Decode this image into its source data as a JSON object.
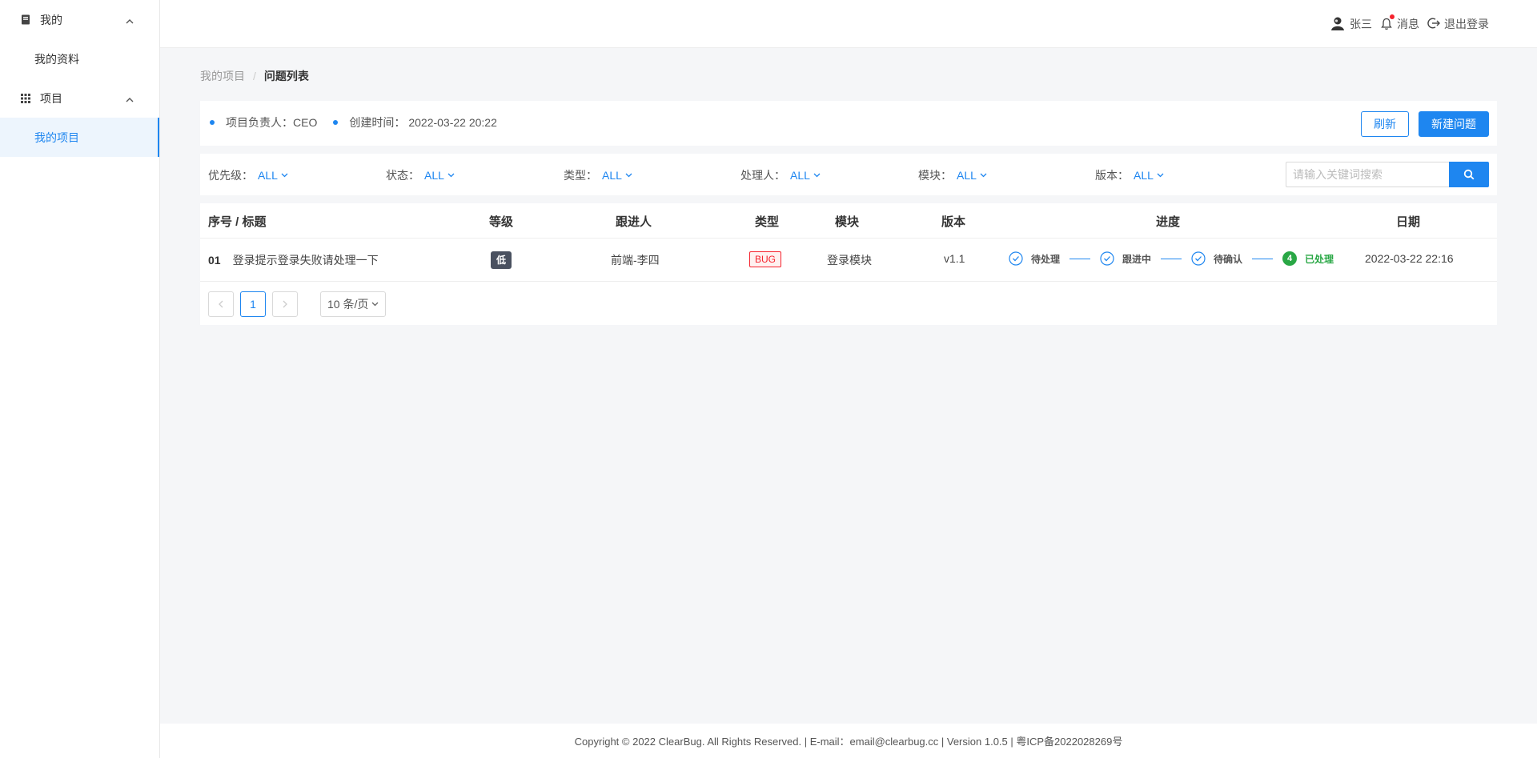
{
  "sidebar": {
    "groups": [
      {
        "label": "我的",
        "icon": "book-icon",
        "items": [
          {
            "label": "我的资料",
            "active": false
          }
        ]
      },
      {
        "label": "项目",
        "icon": "grid-icon",
        "items": [
          {
            "label": "我的项目",
            "active": true
          }
        ]
      }
    ]
  },
  "header": {
    "user_name": "张三",
    "messages_label": "消息",
    "logout_label": "退出登录"
  },
  "breadcrumb": {
    "parent": "我的项目",
    "separator": "/",
    "current": "问题列表"
  },
  "project_info": {
    "owner_label": "项目负责人：",
    "owner_value": "CEO",
    "created_label": "创建时间：",
    "created_value": "2022-03-22 20:22",
    "refresh_label": "刷新",
    "new_issue_label": "新建问题"
  },
  "filters": {
    "priority": {
      "label": "优先级：",
      "value": "ALL"
    },
    "status": {
      "label": "状态：",
      "value": "ALL"
    },
    "type": {
      "label": "类型：",
      "value": "ALL"
    },
    "assignee": {
      "label": "处理人：",
      "value": "ALL"
    },
    "module": {
      "label": "模块：",
      "value": "ALL"
    },
    "version": {
      "label": "版本：",
      "value": "ALL"
    },
    "search_placeholder": "请输入关键词搜索"
  },
  "table": {
    "columns": {
      "title": "序号 / 标题",
      "level": "等级",
      "follower": "跟进人",
      "type": "类型",
      "module": "模块",
      "version": "版本",
      "progress": "进度",
      "date": "日期"
    },
    "rows": [
      {
        "index": "01",
        "title": "登录提示登录失败请处理一下",
        "level": "低",
        "follower": "前端-李四",
        "type": "BUG",
        "module": "登录模块",
        "version": "v1.1",
        "steps": [
          "待处理",
          "跟进中",
          "待确认"
        ],
        "done_step_number": "4",
        "done_step_label": "已处理",
        "date": "2022-03-22 22:16"
      }
    ]
  },
  "pagination": {
    "current_page": "1",
    "page_size": "10 条/页"
  },
  "footer": {
    "text": "Copyright © 2022 ClearBug. All Rights Reserved. | E-mail：email@clearbug.cc | Version 1.0.5 | 粤ICP备2022028269号"
  },
  "colors": {
    "primary": "#1e86f0",
    "success": "#29a745",
    "danger": "#f5222d",
    "badge_dark": "#4a5160"
  }
}
